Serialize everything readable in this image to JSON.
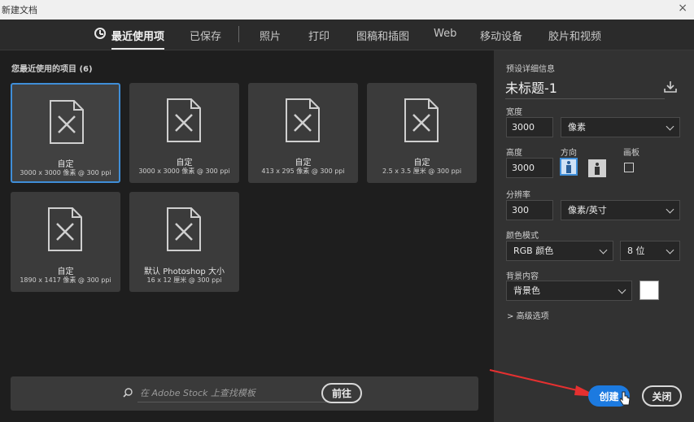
{
  "window": {
    "title": "新建文档",
    "close": "×"
  },
  "tabs": [
    {
      "label": "最近使用项",
      "active": true
    },
    {
      "label": "已保存"
    },
    {
      "label": "照片"
    },
    {
      "label": "打印"
    },
    {
      "label": "图稿和插图"
    },
    {
      "label": "Web"
    },
    {
      "label": "移动设备"
    },
    {
      "label": "胶片和视频"
    }
  ],
  "recent": {
    "title": "您最近使用的项目 (6)",
    "items": [
      {
        "name": "自定",
        "spec": "3000 x 3000 像素 @ 300 ppi",
        "selected": true
      },
      {
        "name": "自定",
        "spec": "3000 x 3000 像素 @ 300 ppi"
      },
      {
        "name": "自定",
        "spec": "413 x 295 像素 @ 300 ppi"
      },
      {
        "name": "自定",
        "spec": "2.5 x 3.5 厘米 @ 300 ppi"
      },
      {
        "name": "自定",
        "spec": "1890 x 1417 像素 @ 300 ppi"
      },
      {
        "name": "默认 Photoshop 大小",
        "spec": "16 x 12 厘米 @ 300 ppi"
      }
    ]
  },
  "search": {
    "placeholder": "在 Adobe Stock 上查找模板",
    "go_label": "前往"
  },
  "details": {
    "section_title": "预设详细信息",
    "doc_name": "未标题-1",
    "width_label": "宽度",
    "width_value": "3000",
    "width_unit": "像素",
    "height_label": "高度",
    "height_value": "3000",
    "orientation_label": "方向",
    "artboard_label": "画板",
    "resolution_label": "分辨率",
    "resolution_value": "300",
    "resolution_unit": "像素/英寸",
    "color_mode_label": "颜色模式",
    "color_mode_value": "RGB 颜色",
    "bit_depth_value": "8 位",
    "background_label": "背景内容",
    "background_value": "背景色",
    "background_color": "#ffffff",
    "advanced_label": "高级选项"
  },
  "actions": {
    "create_label": "创建",
    "close_label": "关闭"
  },
  "colors": {
    "accent": "#1c7ae0",
    "selection": "#3f8ed8",
    "annotation": "#e53030"
  }
}
